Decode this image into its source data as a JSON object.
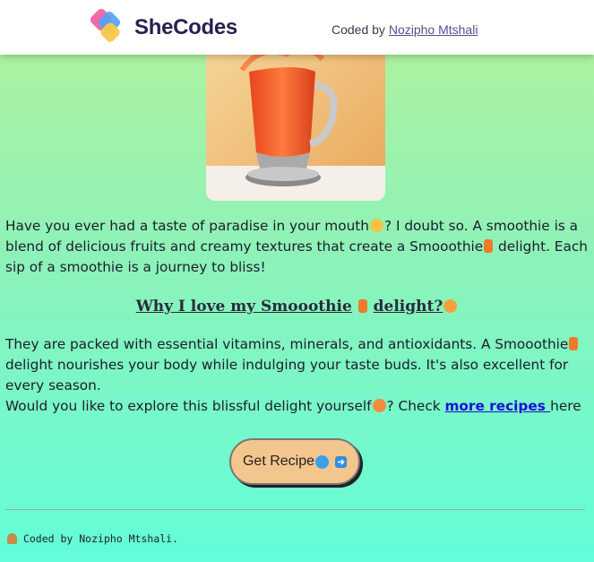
{
  "header": {
    "brand": "SheCodes",
    "credit_prefix": "Coded by",
    "credit_name": "Nozipho Mtshali"
  },
  "hero_image": {
    "icon": "smoothie-blender-image"
  },
  "intro": {
    "part1": "Have you ever had a taste of paradise in your mouth",
    "part2": "? I doubt so. A smoothie is a blend of delicious fruits and creamy textures that create a Smooothie",
    "part3": " delight. Each sip of a smoothie is a journey to bliss!"
  },
  "section": {
    "heading": "Why I love my Smooothie",
    "heading_end": "delight?"
  },
  "body": {
    "part1": "They are packed with essential vitamins, minerals, and antioxidants. A Smooothie",
    "part2": " delight nourishes your body while indulging your taste buds. It's also excellent for every season.",
    "part3": "Would you like to explore this blissful delight yourself",
    "part4": "? Check ",
    "link": "more recipes ",
    "part5": "here"
  },
  "button": {
    "label": "Get Recipe"
  },
  "footer": {
    "text": "Coded by Nozipho Mtshali."
  },
  "colors": {
    "button": "#f3c68e",
    "link": "#1a0dd6",
    "brand": "#2a1f4f"
  }
}
